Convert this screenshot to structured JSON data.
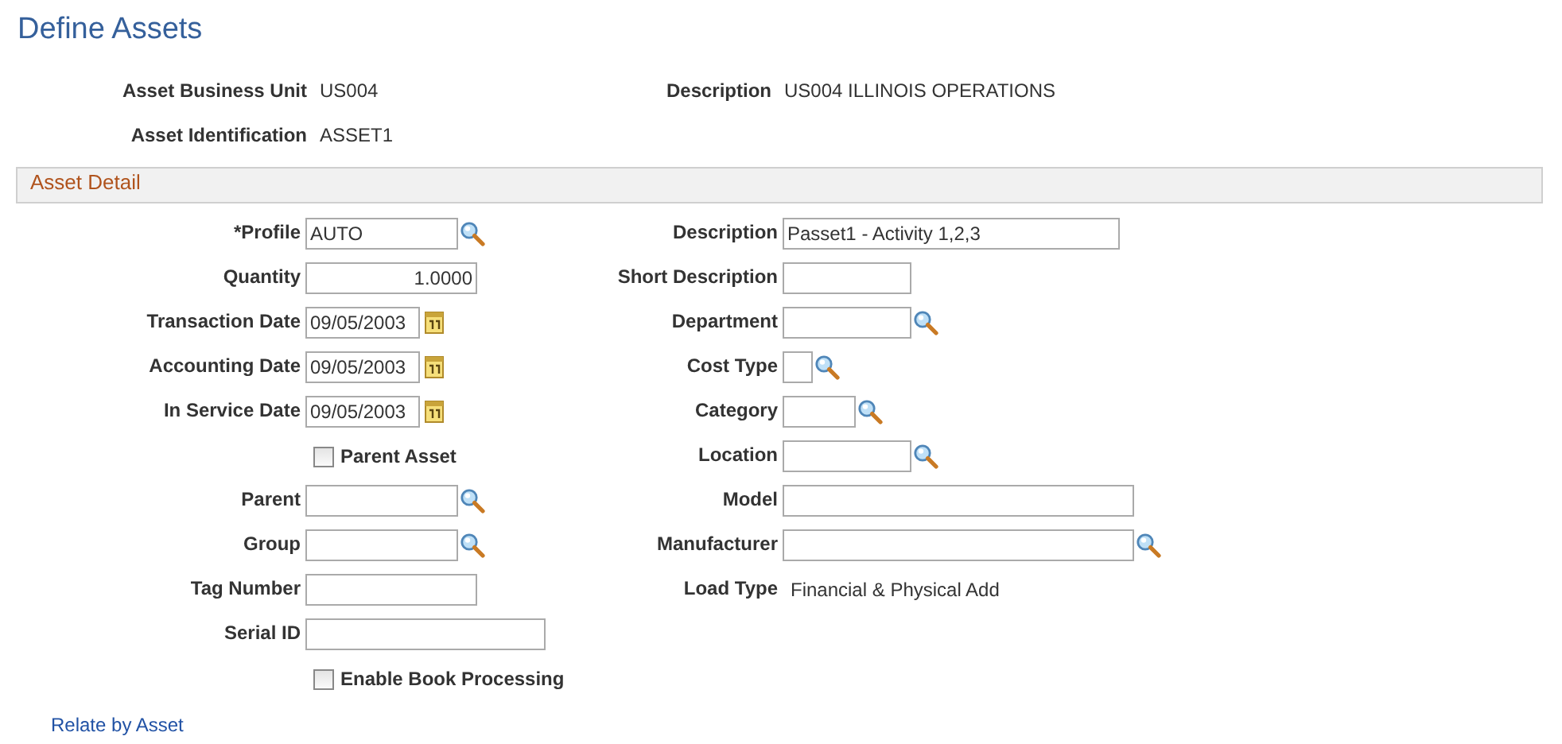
{
  "page_title": "Define Assets",
  "header_fields": [
    {
      "label": "Asset Business Unit",
      "value": "US004"
    },
    {
      "label": "Description",
      "value": "US004 ILLINOIS OPERATIONS"
    },
    {
      "label": "Asset Identification",
      "value": "ASSET1"
    }
  ],
  "section": {
    "title": "Asset Detail",
    "left_fields": [
      {
        "kind": "lookup",
        "label": "*Profile",
        "value": "AUTO"
      },
      {
        "kind": "number",
        "label": "Quantity",
        "value": "1.0000"
      },
      {
        "kind": "date",
        "label": "Transaction Date",
        "value": "09/05/2003"
      },
      {
        "kind": "date",
        "label": "Accounting Date",
        "value": "09/05/2003"
      },
      {
        "kind": "date",
        "label": "In Service Date",
        "value": "09/05/2003"
      },
      {
        "kind": "checkbox",
        "label": "Parent Asset",
        "checked": false
      },
      {
        "kind": "lookup",
        "label": "Parent"
      },
      {
        "kind": "lookup",
        "label": "Group"
      },
      {
        "kind": "text",
        "label": "Tag Number"
      },
      {
        "kind": "text",
        "label": "Serial ID"
      },
      {
        "kind": "checkbox",
        "label": "Enable Book Processing",
        "checked": false
      }
    ],
    "right_fields": [
      {
        "kind": "text",
        "label": "Description",
        "value": "Passet1 - Activity 1,2,3"
      },
      {
        "kind": "text",
        "label": "Short Description"
      },
      {
        "kind": "lookup",
        "label": "Department"
      },
      {
        "kind": "lookup",
        "label": "Cost Type"
      },
      {
        "kind": "lookup",
        "label": "Category"
      },
      {
        "kind": "lookup",
        "label": "Location"
      },
      {
        "kind": "text",
        "label": "Model"
      },
      {
        "kind": "lookup",
        "label": "Manufacturer"
      },
      {
        "kind": "display",
        "label": "Load Type",
        "value": "Financial & Physical Add"
      }
    ]
  },
  "link": "Relate by Asset"
}
